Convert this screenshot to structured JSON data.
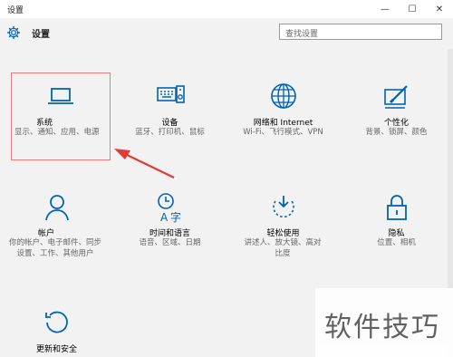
{
  "window": {
    "title": "设置",
    "minimize": "—",
    "maximize": "☐",
    "close": "✕"
  },
  "header": {
    "app_title": "设置",
    "search_placeholder": "查找设置"
  },
  "tiles": [
    {
      "label": "系统",
      "desc": "显示、通知、应用、电源",
      "icon": "laptop-icon"
    },
    {
      "label": "设备",
      "desc": "蓝牙、打印机、鼠标",
      "icon": "keyboard-speaker-icon"
    },
    {
      "label": "网络和 Internet",
      "desc": "Wi-Fi、飞行模式、VPN",
      "icon": "globe-icon"
    },
    {
      "label": "个性化",
      "desc": "背景、锁屏、颜色",
      "icon": "paint-icon"
    },
    {
      "label": "帐户",
      "desc": "你的帐户、电子邮件、同步设置、工作、其他用户",
      "icon": "person-icon"
    },
    {
      "label": "时间和语言",
      "desc": "语音、区域、日期",
      "icon": "time-language-icon"
    },
    {
      "label": "轻松使用",
      "desc": "讲述人、放大镜、高对比度",
      "icon": "ease-of-access-icon"
    },
    {
      "label": "隐私",
      "desc": "位置、相机",
      "icon": "lock-icon"
    },
    {
      "label": "更新和安全",
      "desc": "",
      "icon": "refresh-icon"
    }
  ],
  "watermark": "软件技巧",
  "colors": {
    "accent": "#0063b1",
    "highlight_border": "#e87c7c",
    "arrow": "#e53935"
  }
}
